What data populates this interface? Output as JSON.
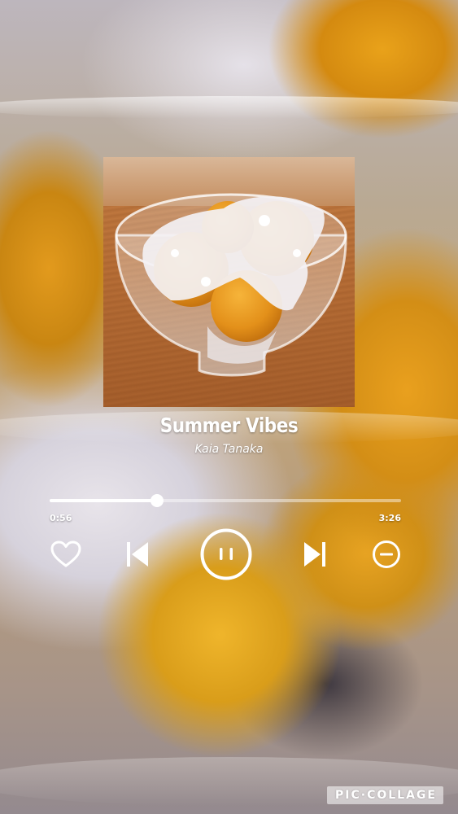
{
  "song": {
    "title": "Summer Vibes",
    "artist": "Kaia Tanaka"
  },
  "playback": {
    "elapsed": "0:56",
    "total": "3:26",
    "progress_fraction": 0.305,
    "state": "playing"
  },
  "controls": {
    "like_icon": "heart-outline-icon",
    "previous_icon": "skip-previous-icon",
    "play_pause_icon": "pause-icon",
    "next_icon": "skip-next-icon",
    "remove_icon": "minus-circle-icon"
  },
  "watermark": {
    "text": "PIC·COLLAGE"
  },
  "colors": {
    "foreground": "#ffffff",
    "kumquat": "#e39a1e",
    "sugar": "#f1eef2"
  }
}
